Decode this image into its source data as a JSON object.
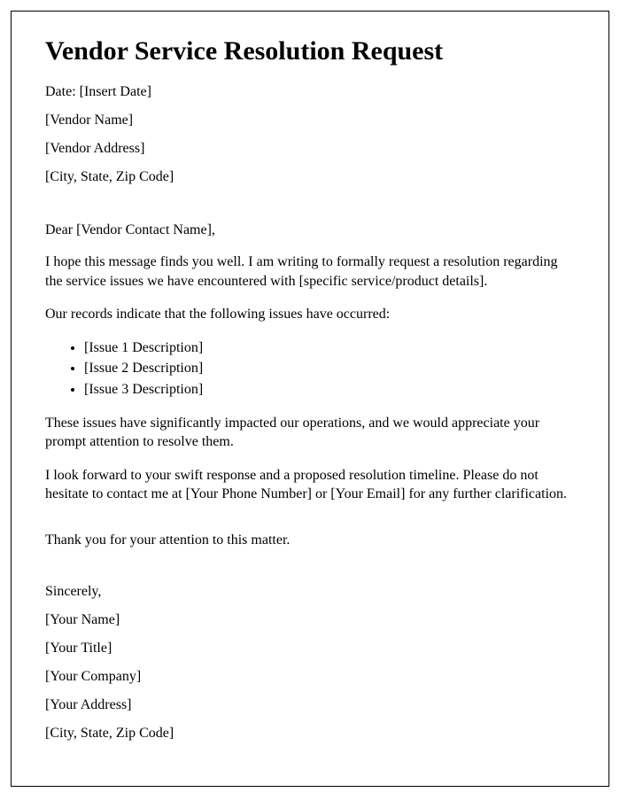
{
  "title": "Vendor Service Resolution Request",
  "header": {
    "date": "Date: [Insert Date]",
    "vendor_name": "[Vendor Name]",
    "vendor_address": "[Vendor Address]",
    "vendor_csz": "[City, State, Zip Code]"
  },
  "salutation": "Dear [Vendor Contact Name],",
  "body": {
    "intro": "I hope this message finds you well. I am writing to formally request a resolution regarding the service issues we have encountered with [specific service/product details].",
    "records_lead": "Our records indicate that the following issues have occurred:",
    "issues": [
      "[Issue 1 Description]",
      "[Issue 2 Description]",
      "[Issue 3 Description]"
    ],
    "impact": "These issues have significantly impacted our operations, and we would appreciate your prompt attention to resolve them.",
    "closing": "I look forward to your swift response and a proposed resolution timeline. Please do not hesitate to contact me at [Your Phone Number] or [Your Email] for any further clarification."
  },
  "thanks": "Thank you for your attention to this matter.",
  "signature": {
    "sincerely": "Sincerely,",
    "name": "[Your Name]",
    "title": "[Your Title]",
    "company": "[Your Company]",
    "address": "[Your Address]",
    "csz": "[City, State, Zip Code]"
  }
}
